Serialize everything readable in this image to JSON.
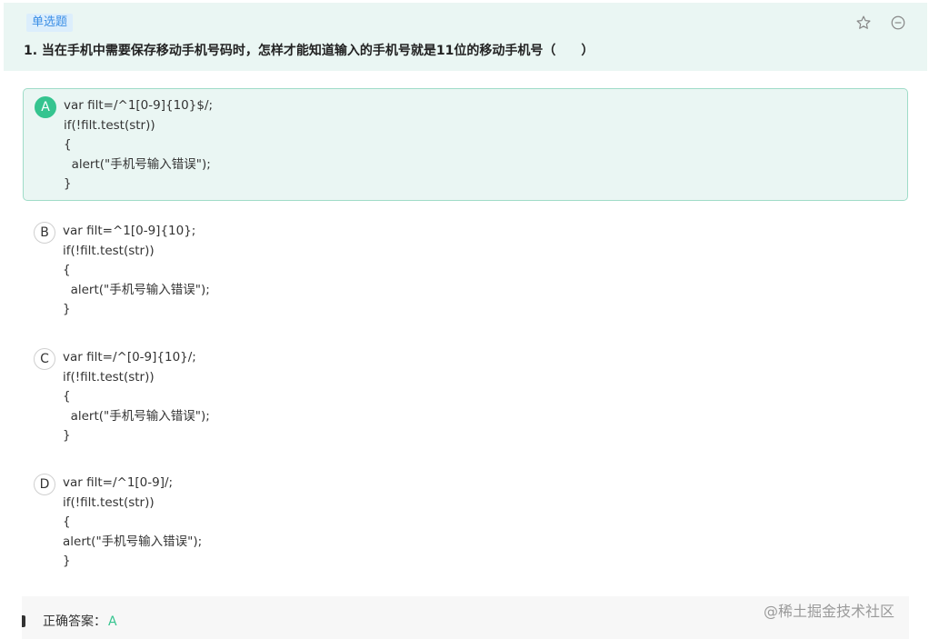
{
  "question": {
    "type_badge": "单选题",
    "text": "1. 当在手机中需要保存移动手机号码时，怎样才能知道输入的手机号就是11位的移动手机号（　　）",
    "actions": {
      "favorite_icon": "star-icon",
      "remove_icon": "minus-circle-icon"
    }
  },
  "options": [
    {
      "letter": "A",
      "selected": true,
      "lines": [
        "var filt=/^1[0-9]{10}$/;",
        "if(!filt.test(str))",
        "{",
        "  alert(\"手机号输入错误\");",
        "}"
      ]
    },
    {
      "letter": "B",
      "selected": false,
      "lines": [
        "var filt=^1[0-9]{10};",
        "if(!filt.test(str))",
        "{",
        "  alert(\"手机号输入错误\");",
        "}"
      ]
    },
    {
      "letter": "C",
      "selected": false,
      "lines": [
        "var filt=/^[0-9]{10}/;",
        "if(!filt.test(str))",
        "{",
        "  alert(\"手机号输入错误\");",
        "}"
      ]
    },
    {
      "letter": "D",
      "selected": false,
      "lines": [
        "var filt=/^1[0-9]/;",
        "if(!filt.test(str))",
        "{",
        "alert(\"手机号输入错误\");",
        "}"
      ]
    }
  ],
  "answer": {
    "label": "正确答案：",
    "value": "A"
  },
  "watermark": "@稀土掘金技术社区",
  "colors": {
    "accent": "#35c48f",
    "header_bg": "#eaf6f3",
    "badge_text": "#3a8ee6"
  }
}
